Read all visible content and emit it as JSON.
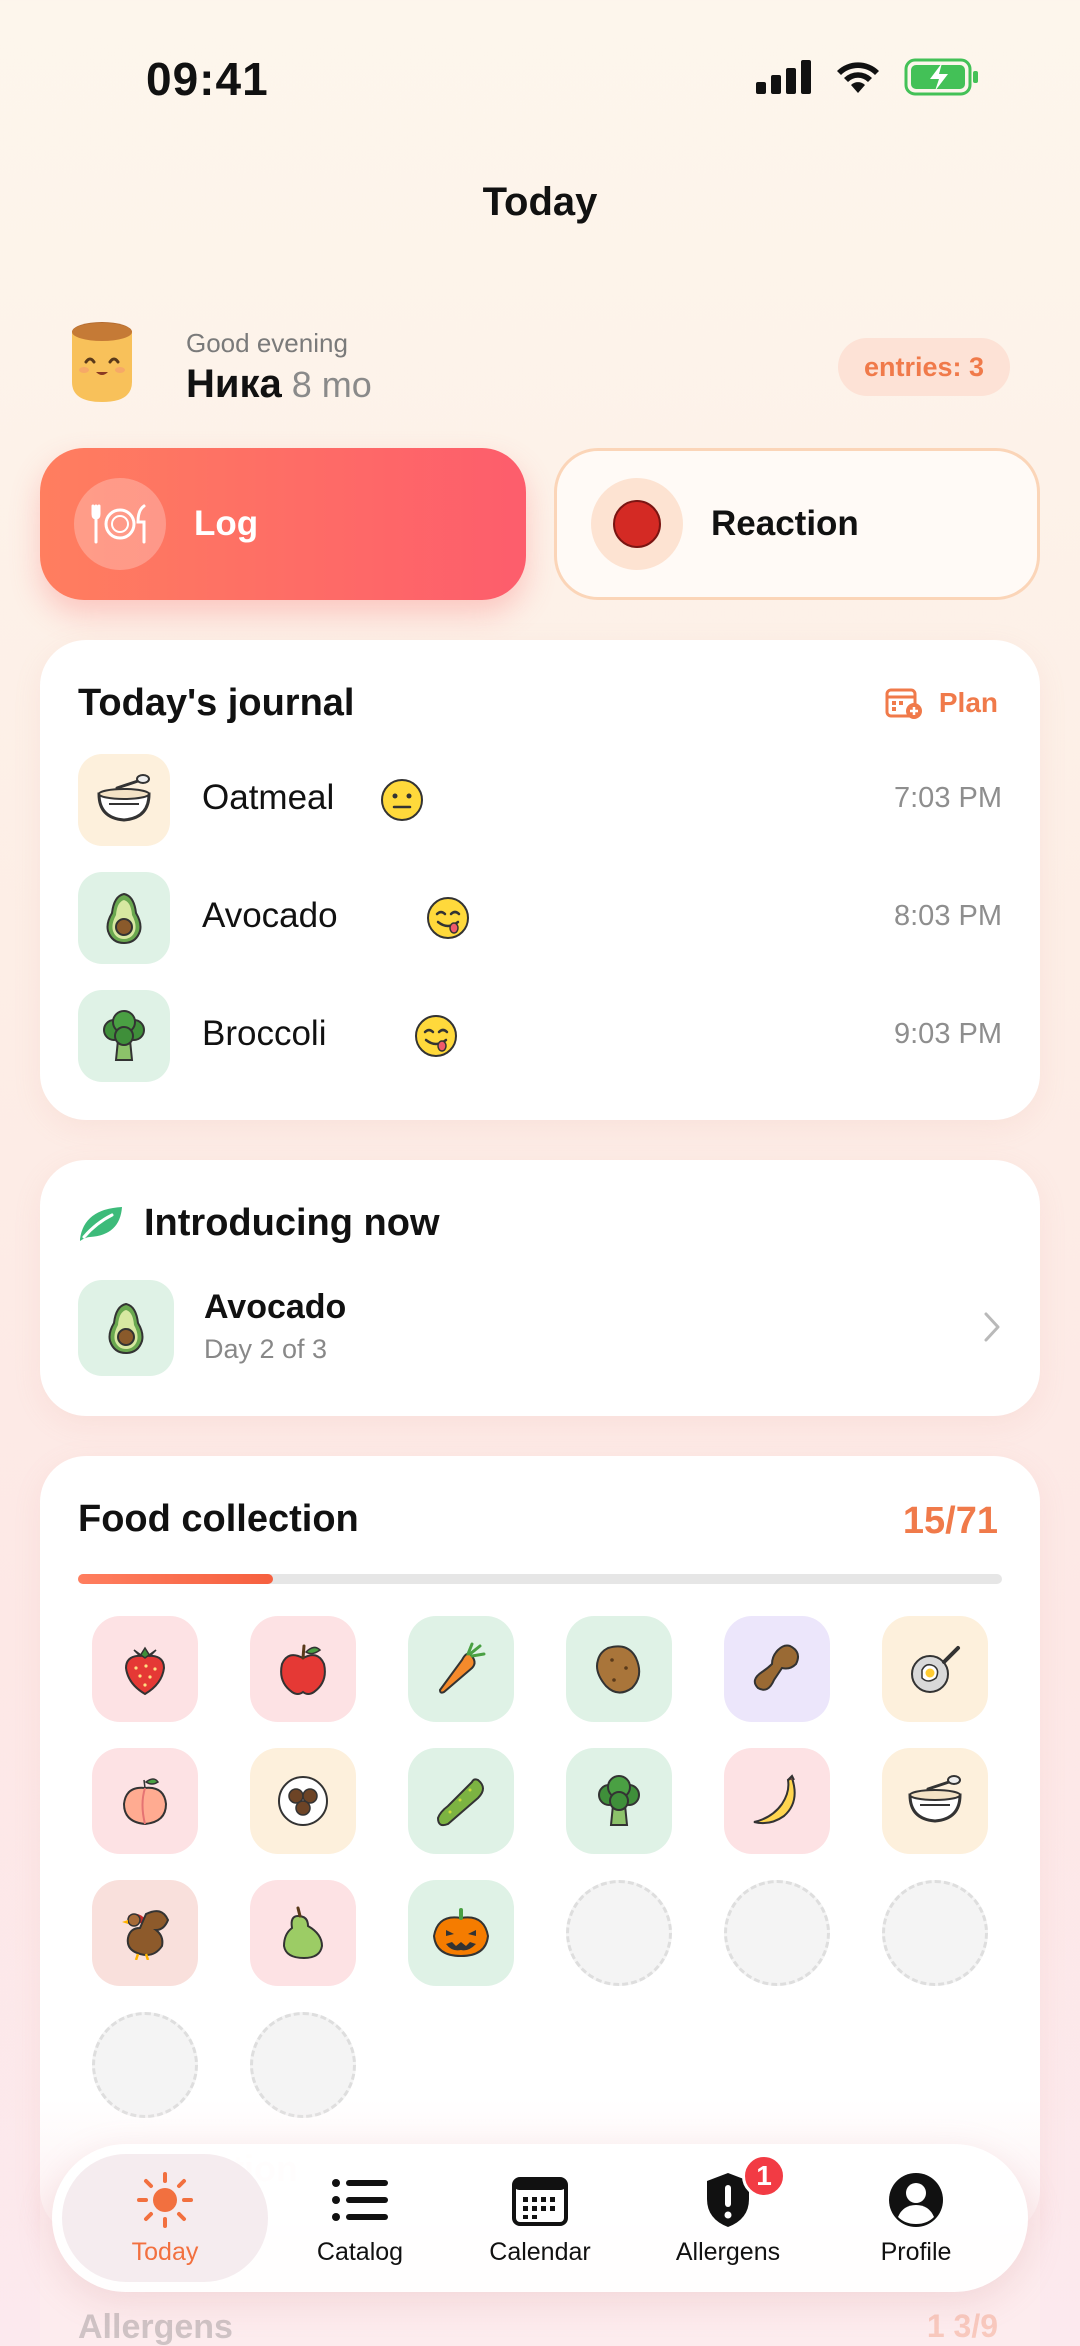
{
  "status_bar": {
    "time": "09:41"
  },
  "nav": {
    "title": "Today"
  },
  "greeting": {
    "salutation": "Good evening",
    "name": "Ника",
    "age": "8 mo",
    "entries_badge": "entries: 3"
  },
  "actions": {
    "log_label": "Log",
    "reaction_label": "Reaction"
  },
  "journal": {
    "title": "Today's journal",
    "plan_label": "Plan",
    "entries": [
      {
        "food": "Oatmeal",
        "time": "7:03 PM",
        "reaction": "neutral-face"
      },
      {
        "food": "Avocado",
        "time": "8:03 PM",
        "reaction": "yum-face"
      },
      {
        "food": "Broccoli",
        "time": "9:03 PM",
        "reaction": "yum-face"
      }
    ]
  },
  "introducing": {
    "title": "Introducing now",
    "food": "Avocado",
    "progress": "Day 2 of 3"
  },
  "collection": {
    "title": "Food collection",
    "count": "15/71",
    "progress_fraction": 0.211,
    "items": [
      "strawberry",
      "apple",
      "carrot",
      "potato",
      "peanut",
      "egg",
      "peach",
      "meatballs",
      "cucumber",
      "broccoli",
      "banana",
      "oatmeal",
      "turkey",
      "pear",
      "pumpkin"
    ],
    "empty_slots": 5
  },
  "behind": {
    "ghost_collection": "collection",
    "allergens": "Allergens",
    "allergens_count": "3/9",
    "allergens_count_badge": "1"
  },
  "tabs": [
    {
      "label": "Today",
      "icon": "sun-icon",
      "active": true
    },
    {
      "label": "Catalog",
      "icon": "list-icon"
    },
    {
      "label": "Calendar",
      "icon": "calendar-icon"
    },
    {
      "label": "Allergens",
      "icon": "shield-alert-icon",
      "badge": "1"
    },
    {
      "label": "Profile",
      "icon": "person-icon"
    }
  ],
  "colors": {
    "accent": "#f07a4a",
    "log_gradient_start": "#ff7e5f",
    "log_gradient_end": "#fd5d6c",
    "badge_red": "#f23b44"
  }
}
